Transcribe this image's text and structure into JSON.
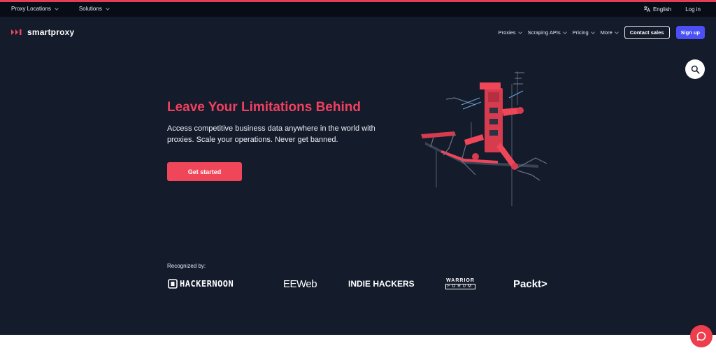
{
  "topbar": {
    "proxy_locations": "Proxy Locations",
    "solutions": "Solutions",
    "language": "English",
    "login": "Log in"
  },
  "nav": {
    "brand": "smartproxy",
    "links": [
      "Proxies",
      "Scraping APIs",
      "Pricing",
      "More"
    ],
    "contact_sales": "Contact sales",
    "sign_up": "Sign up"
  },
  "hero": {
    "title": "Leave Your Limitations Behind",
    "subtitle": "Access competitive business data anywhere in the world with proxies. Scale your operations. Never get banned.",
    "cta": "Get started"
  },
  "recognized": {
    "label": "Recognized by:",
    "brands": [
      "HACKERNOON",
      "EEWeb",
      "INDIE HACKERS",
      "WARRIOR",
      "FORUM",
      "Packt>"
    ]
  },
  "colors": {
    "accent": "#ef4659",
    "signup": "#4a50f5",
    "background": "#141b2b",
    "topbar": "#080c17"
  },
  "icons": [
    "translate-icon",
    "search-icon",
    "chat-icon",
    "logo-icon",
    "chevron-down-icon"
  ]
}
